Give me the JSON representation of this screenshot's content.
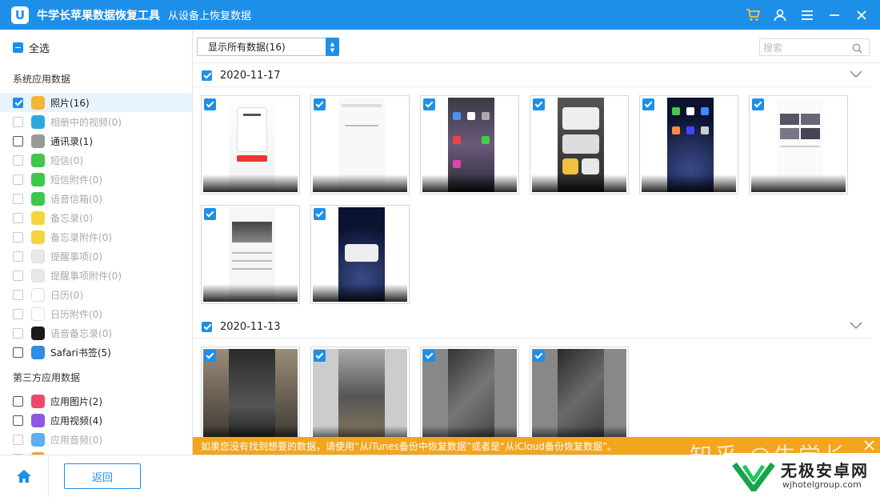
{
  "titlebar": {
    "app_name": "牛学长苹果数据恢复工具",
    "subtitle": "从设备上恢复数据",
    "logo_letter": "U"
  },
  "sidebar": {
    "select_all": "全选",
    "system_group": "系统应用数据",
    "system_items": [
      {
        "label": "照片(16)",
        "state": "checked",
        "icon": "photos-icon",
        "color": "#f1b63b"
      },
      {
        "label": "相册中的视频(0)",
        "state": "empty",
        "icon": "album-video-icon",
        "color": "#2fa7e0"
      },
      {
        "label": "通讯录(1)",
        "state": "unchecked",
        "icon": "contacts-icon",
        "color": "#9a9a9a"
      },
      {
        "label": "短信(0)",
        "state": "empty",
        "icon": "messages-icon",
        "color": "#3cc84a"
      },
      {
        "label": "短信附件(0)",
        "state": "empty",
        "icon": "message-attachment-icon",
        "color": "#3cc84a"
      },
      {
        "label": "语音信箱(0)",
        "state": "empty",
        "icon": "voicemail-icon",
        "color": "#3cc84a"
      },
      {
        "label": "备忘录(0)",
        "state": "empty",
        "icon": "notes-icon",
        "color": "#f5d33d"
      },
      {
        "label": "备忘录附件(0)",
        "state": "empty",
        "icon": "notes-attachment-icon",
        "color": "#f5d33d"
      },
      {
        "label": "提醒事项(0)",
        "state": "empty",
        "icon": "reminders-icon",
        "color": "#e8e8e8"
      },
      {
        "label": "提醒事项附件(0)",
        "state": "empty",
        "icon": "reminders-attachment-icon",
        "color": "#e8e8e8"
      },
      {
        "label": "日历(0)",
        "state": "empty",
        "icon": "calendar-icon",
        "color": "#ffffff"
      },
      {
        "label": "日历附件(0)",
        "state": "empty",
        "icon": "calendar-attachment-icon",
        "color": "#ffffff"
      },
      {
        "label": "语音备忘录(0)",
        "state": "empty",
        "icon": "voice-memo-icon",
        "color": "#1a1a1a"
      },
      {
        "label": "Safari书签(5)",
        "state": "unchecked",
        "icon": "safari-icon",
        "color": "#2e8de5"
      }
    ],
    "third_party_group": "第三方应用数据",
    "third_party_items": [
      {
        "label": "应用图片(2)",
        "state": "unchecked",
        "icon": "app-photos-icon",
        "color": "#ec4a6a"
      },
      {
        "label": "应用视频(4)",
        "state": "unchecked",
        "icon": "app-video-icon",
        "color": "#8e57e6"
      },
      {
        "label": "应用音频(0)",
        "state": "empty",
        "icon": "app-audio-icon",
        "color": "#5ab0f0"
      },
      {
        "label": "应用文档(0)",
        "state": "empty",
        "icon": "app-docs-icon",
        "color": "#f0a030"
      }
    ]
  },
  "toolbar": {
    "filter_value": "显示所有数据(16)",
    "search_placeholder": "搜索"
  },
  "groups": [
    {
      "date": "2020-11-17",
      "count": 8
    },
    {
      "date": "2020-11-13",
      "count": 4
    }
  ],
  "banner": {
    "text": "如果您没有找到想要的数据，请使用“从iTunes备份中恢复数据”或者是“从iCloud备份恢复数据”。"
  },
  "footer": {
    "back_label": "返回"
  },
  "watermark": {
    "zhihu": "知乎 @牛学长",
    "site_name": "无极安卓网",
    "site_url": "wjhotelgroup.com"
  },
  "colors": {
    "accent": "#1e8fe8",
    "banner": "#f3a51e"
  }
}
